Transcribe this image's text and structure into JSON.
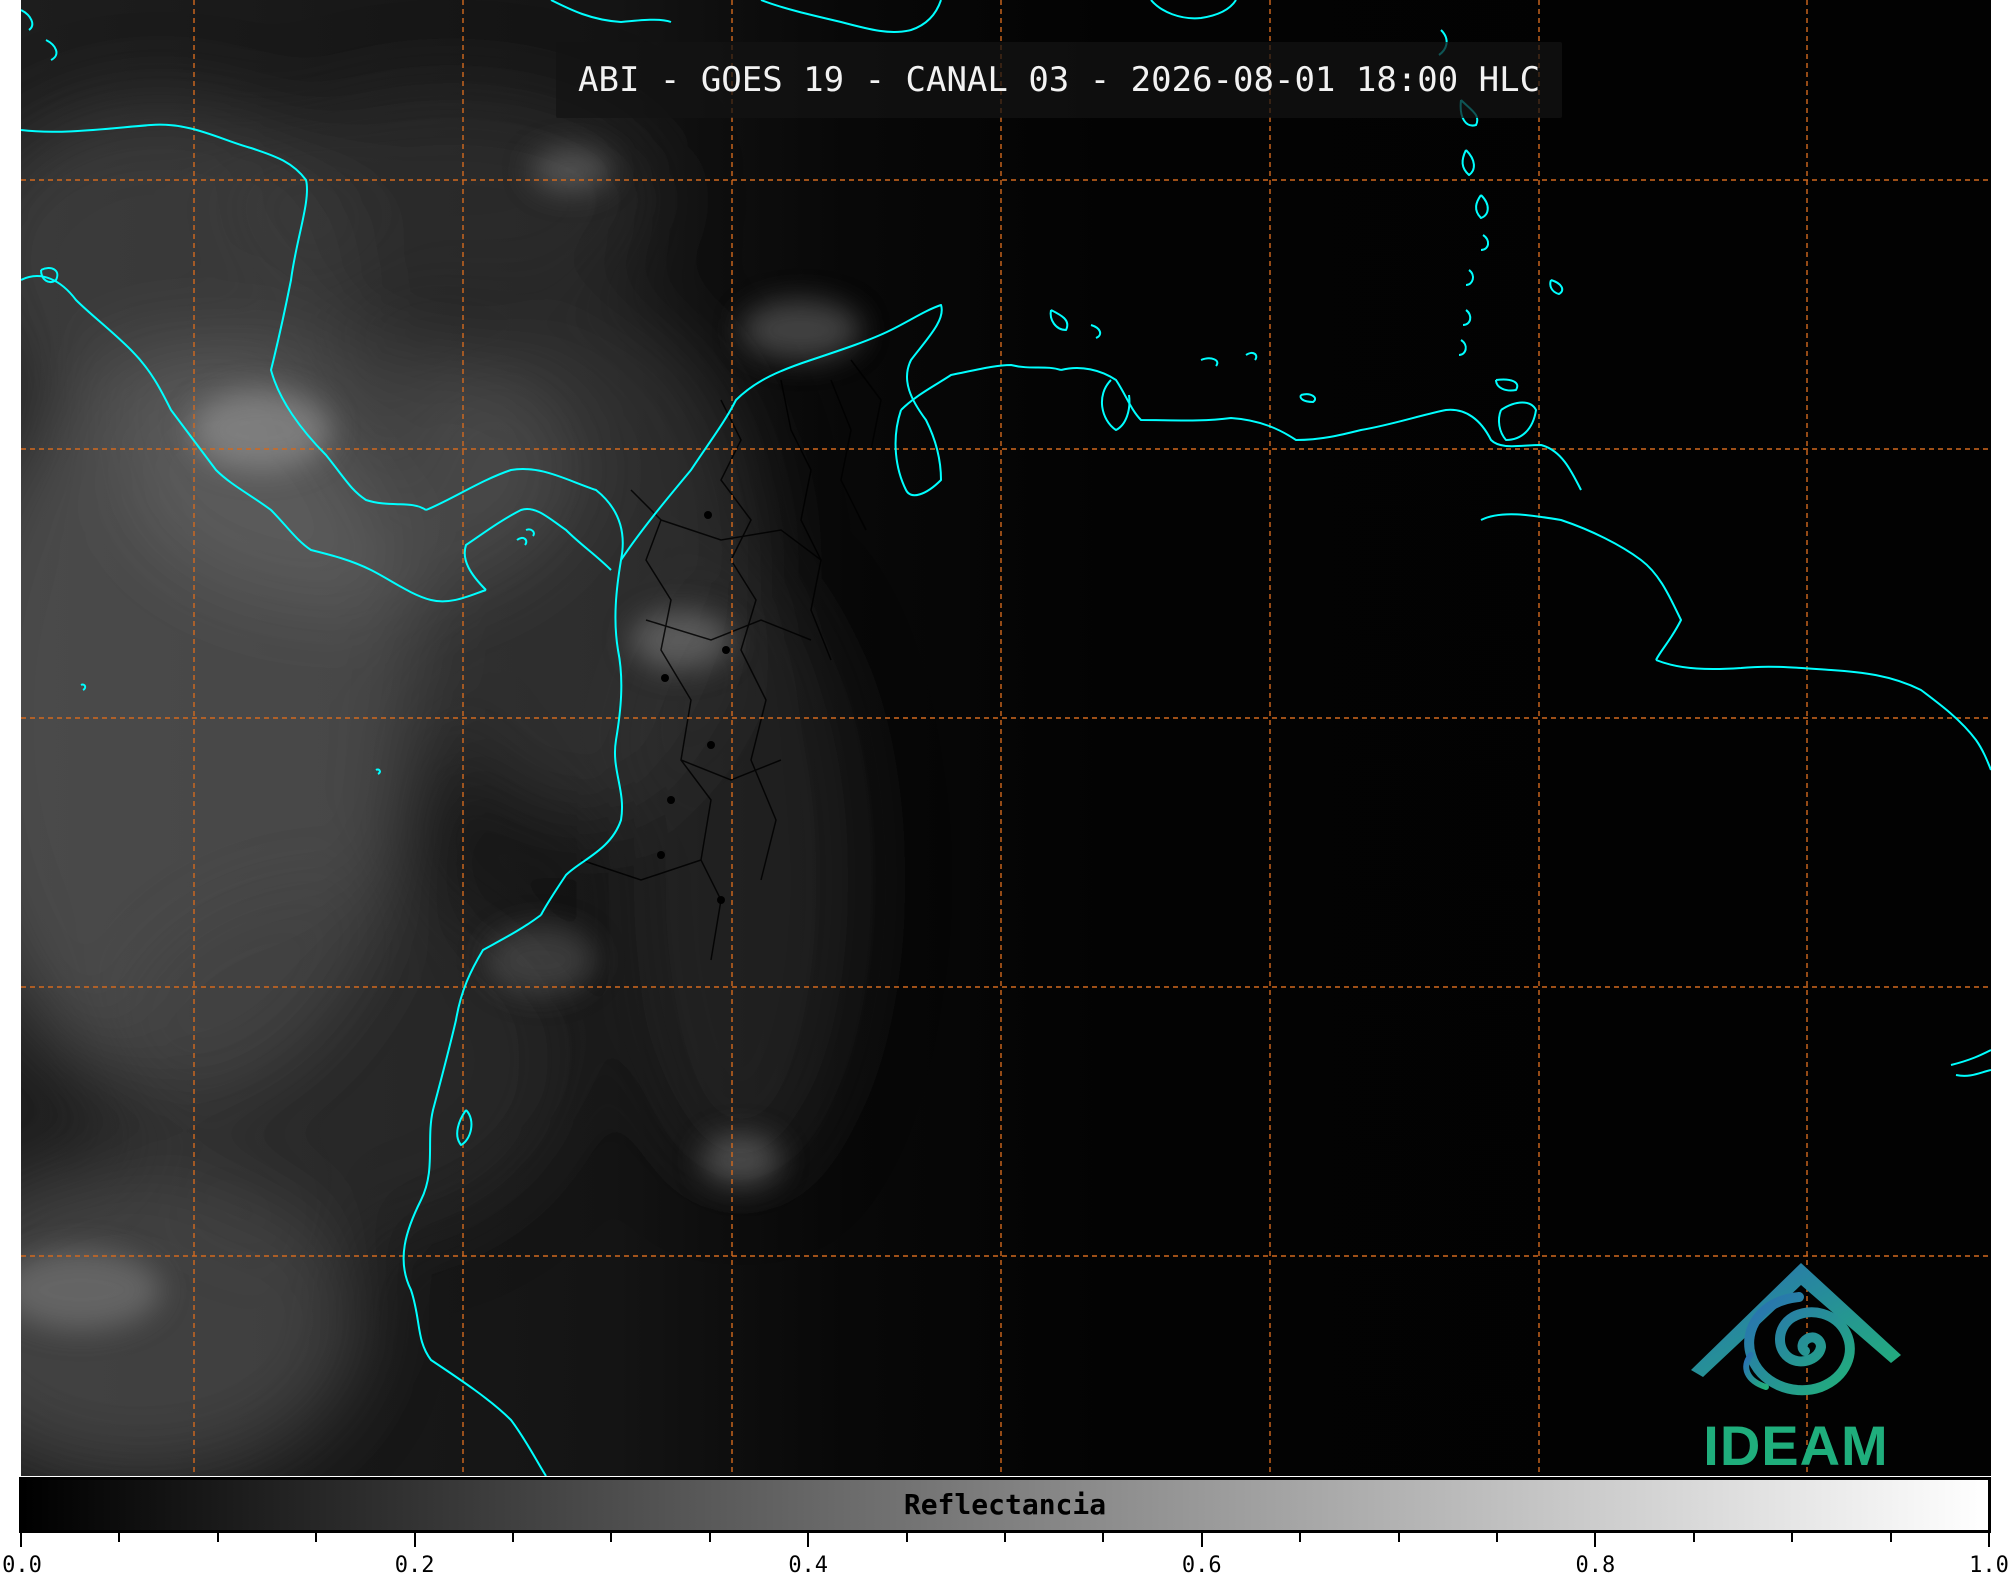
{
  "title": "ABI - GOES 19 - CANAL 03 - 2026-08-01 18:00 HLC",
  "colorbar": {
    "label": "Reflectancia",
    "min": 0.0,
    "max": 1.0,
    "major_ticks": [
      0.0,
      0.2,
      0.4,
      0.6,
      0.8,
      1.0
    ],
    "major_labels": [
      "0.0",
      "0.2",
      "0.4",
      "0.6",
      "0.8",
      "1.0"
    ],
    "minor_step": 0.05,
    "colormap": "grayscale black-to-white"
  },
  "logo": {
    "text": "IDEAM",
    "colors": {
      "text": "#1fae7c",
      "mark_gradient_start": "#2a6fb5",
      "mark_gradient_end": "#22b07a"
    }
  },
  "map": {
    "colors": {
      "coastline": "#00ffff",
      "graticule": "#d2691e",
      "admin_borders": "#000000",
      "background": "#050505"
    },
    "graticule": "dashed",
    "imagery": "visible reflectance, clouds over western half"
  }
}
